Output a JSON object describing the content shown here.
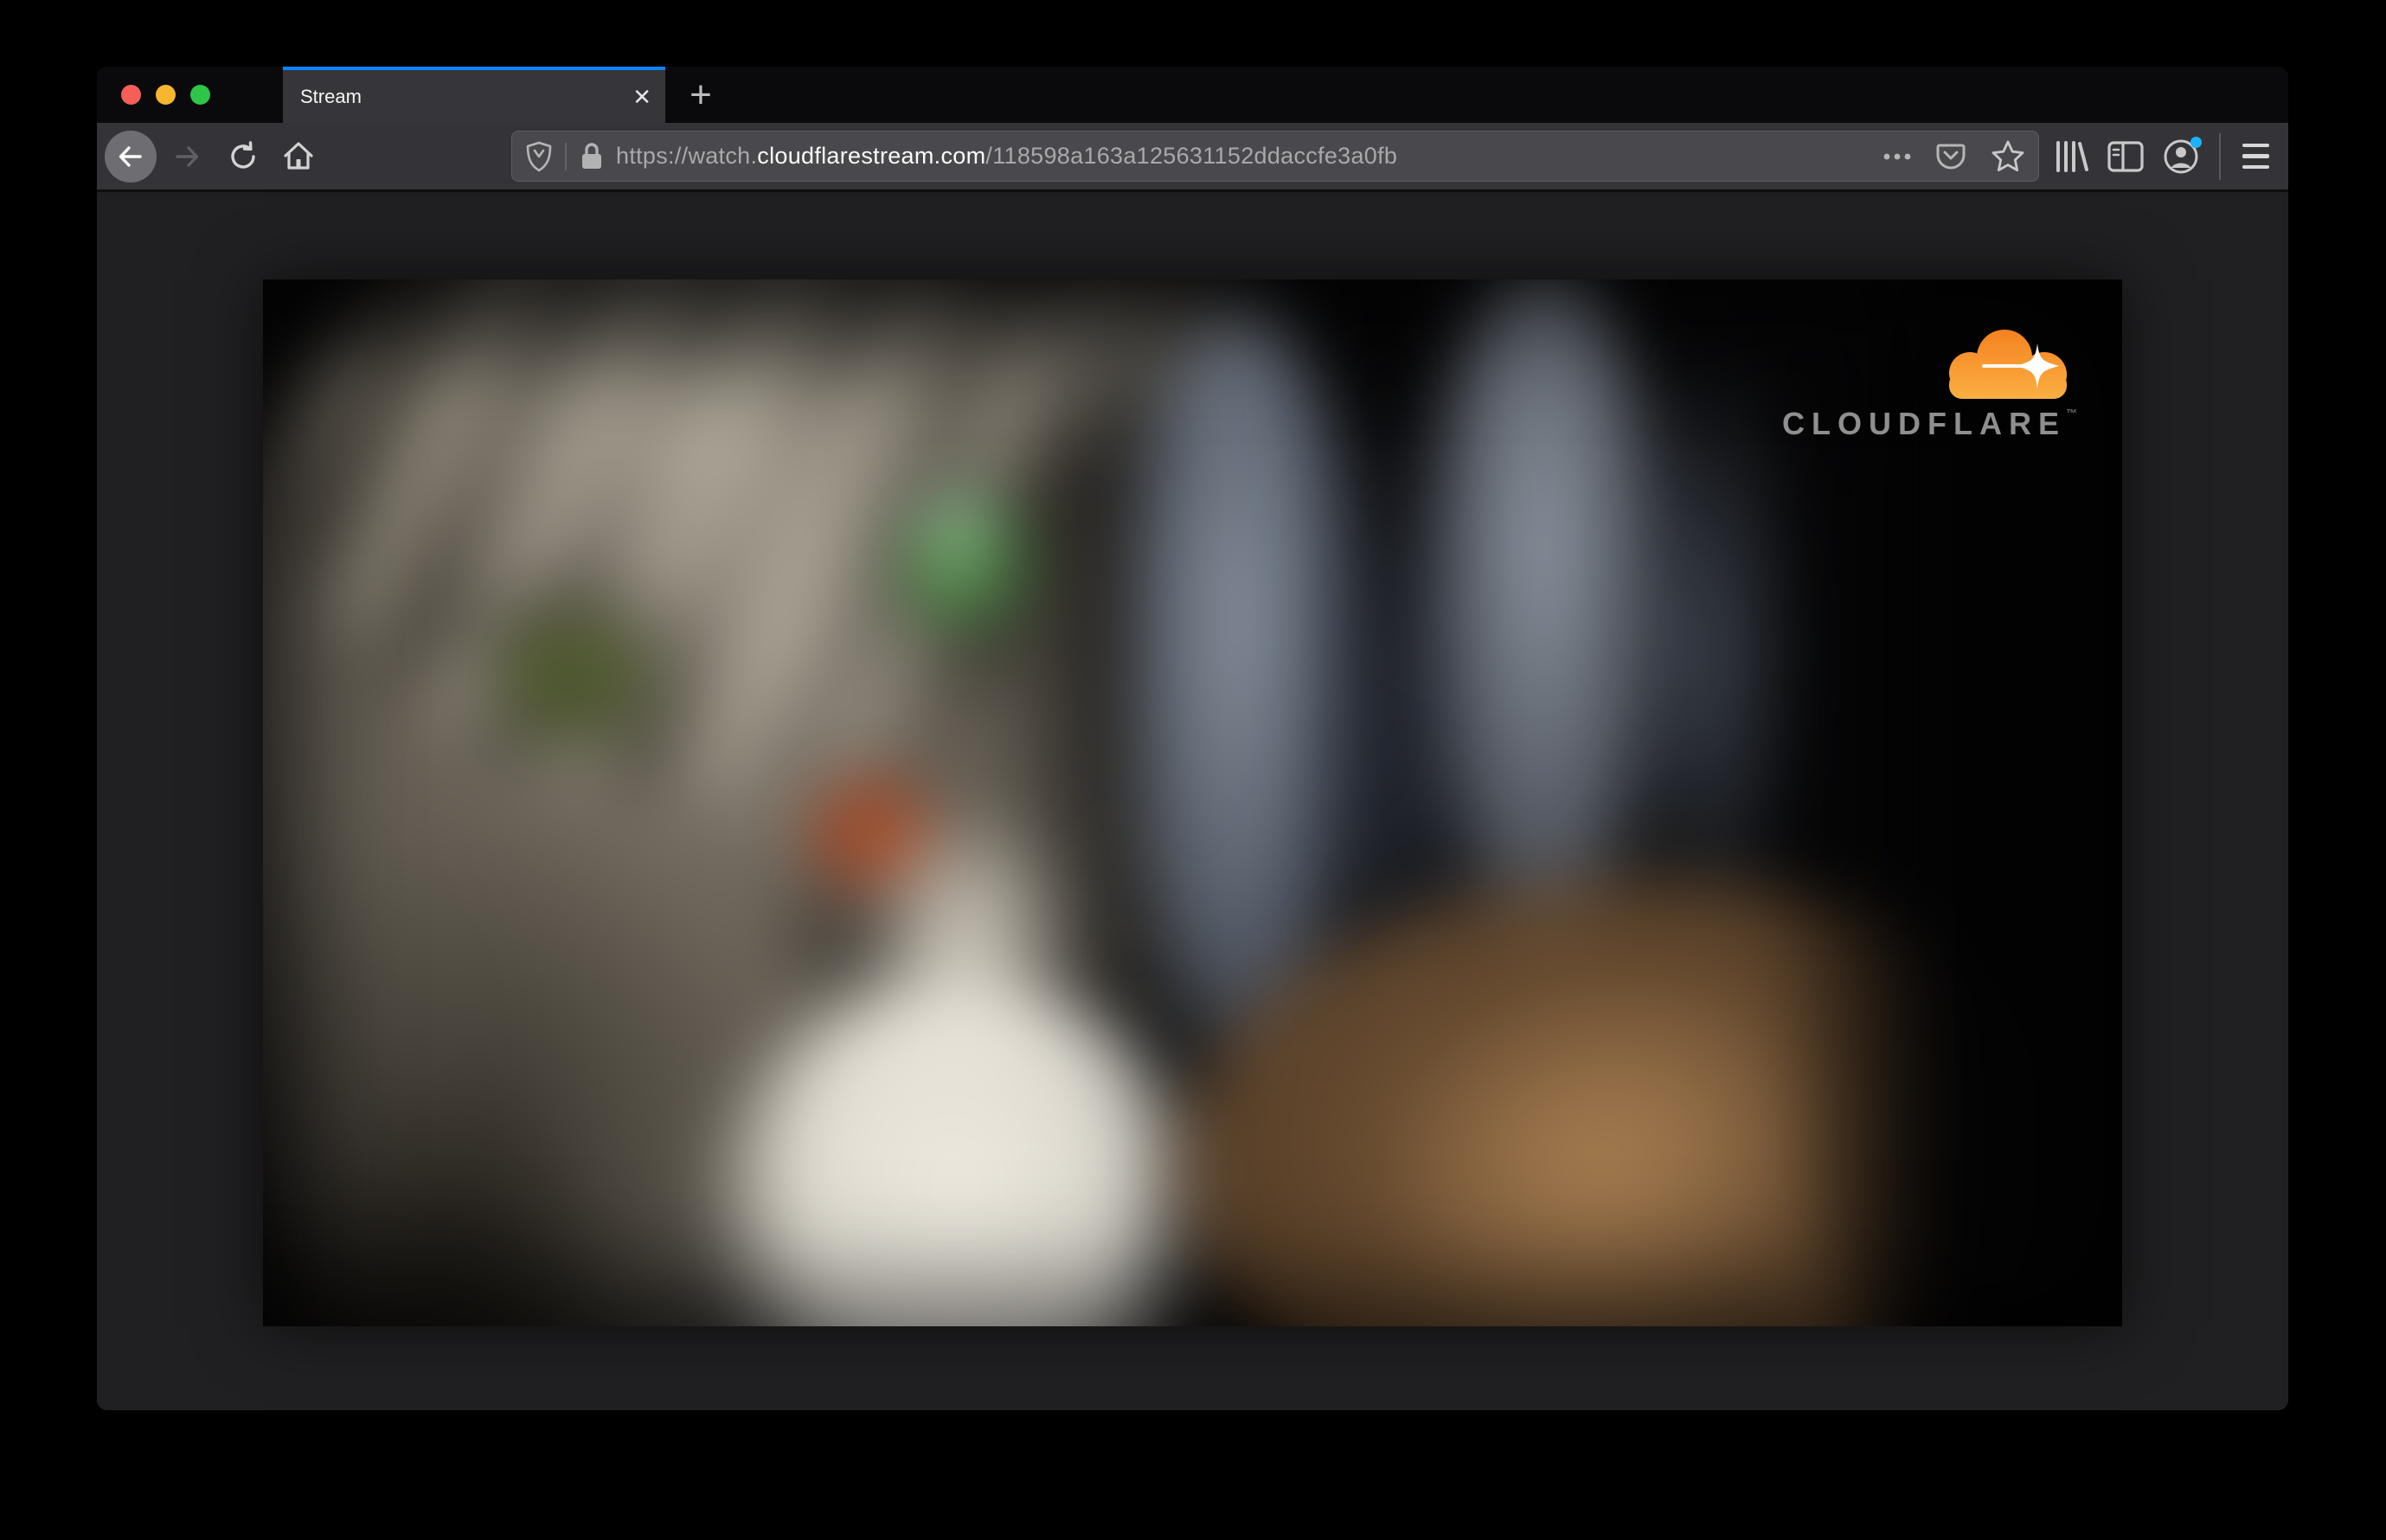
{
  "page": {
    "background": "#000000"
  },
  "browser": {
    "tab": {
      "title": "Stream"
    },
    "url": {
      "scheme": "https://watch.",
      "domain": "cloudflarestream.com",
      "path": "/118598a163a125631152ddaccfe3a0fb",
      "full": "https://watch.cloudflarestream.com/118598a163a125631152ddaccfe3a0fb"
    },
    "colors": {
      "accent_blue": "#0a84ff",
      "tabbar_bg": "#0a0a0c",
      "toolbar_bg": "#343438",
      "urlbar_bg": "#49494d",
      "content_bg": "#202022",
      "notification_dot": "#1ab2ff",
      "traffic_red": "#f55f58",
      "traffic_yellow": "#f6b62e",
      "traffic_green": "#2dc649"
    }
  },
  "glyphs": {
    "close": "✕",
    "plus": "+"
  },
  "icons": {
    "back": "arrow-left",
    "forward": "arrow-right",
    "reload": "refresh",
    "home": "house",
    "shield": "tracking-protection-shield",
    "lock": "padlock",
    "page_actions": "three-dots",
    "pocket": "pocket-save",
    "bookmark": "star-outline",
    "library": "books",
    "sidebar": "sidebar-panel",
    "account": "person-circle",
    "menu": "hamburger"
  },
  "video": {
    "alt": "Blurred close-up of a gray tabby cat with green eyes, white chest, rust-colored nose; blue-gray bokeh background on the right",
    "brand": {
      "name": "CLOUDFLARE",
      "trademark": "™",
      "cloud_orange_dark": "#f48120",
      "cloud_orange_light": "#fbaf42",
      "text_color": "#8f8f90"
    }
  }
}
